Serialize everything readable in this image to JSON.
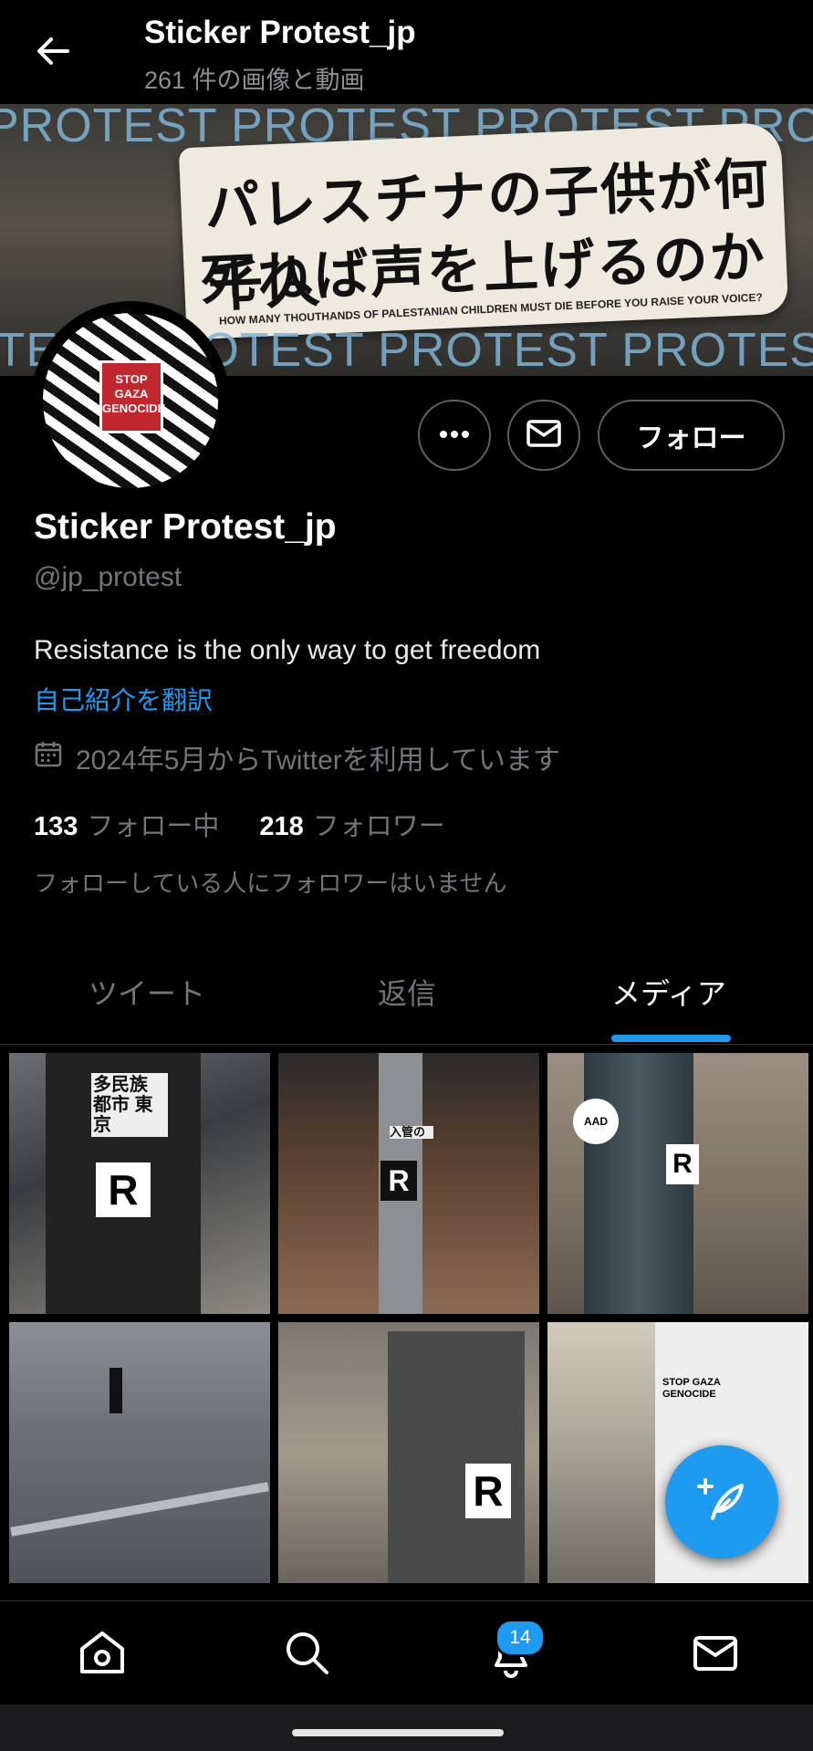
{
  "header": {
    "title": "Sticker Protest_jp",
    "subtitle": "261 件の画像と動画"
  },
  "banner": {
    "stripe_text": "PROTEST PROTEST PROTEST PROTEST",
    "sticker_line1": "パレスチナの子供が何千人",
    "sticker_line2": "死ねば声を上げるのか",
    "sticker_line3": "HOW MANY THOUTHANDS OF PALESTANIAN CHILDREN MUST DIE BEFORE YOU RAISE YOUR VOICE?"
  },
  "avatar": {
    "badge_text": "STOP GAZA GENOCIDE"
  },
  "actions": {
    "follow_label": "フォロー"
  },
  "profile": {
    "name": "Sticker Protest_jp",
    "handle": "@jp_protest",
    "bio": "Resistance is the only way to get freedom",
    "translate": "自己紹介を翻訳",
    "joined": "2024年5月からTwitterを利用しています",
    "following_count": "133",
    "following_label": "フォロー中",
    "followers_count": "218",
    "followers_label": "フォロワー",
    "no_followers_note": "フォローしている人にフォロワーはいません"
  },
  "tabs": [
    {
      "label": "ツイート",
      "active": false
    },
    {
      "label": "返信",
      "active": false
    },
    {
      "label": "メディア",
      "active": true
    }
  ],
  "media_grid": [
    {
      "sticker": "R",
      "sign": "多民族 都市 東京"
    },
    {
      "sticker": "R",
      "sign": "入管の"
    },
    {
      "sticker": "R",
      "sign": "AAD"
    },
    {
      "sticker": "",
      "sign": ""
    },
    {
      "sticker": "R",
      "sign": ""
    },
    {
      "sticker": "",
      "sign": "STOP GAZA GENOCIDE"
    }
  ],
  "bottom_nav": {
    "notifications_badge": "14"
  },
  "colors": {
    "accent": "#1d9bf0",
    "background": "#000000",
    "muted": "#71767b"
  }
}
